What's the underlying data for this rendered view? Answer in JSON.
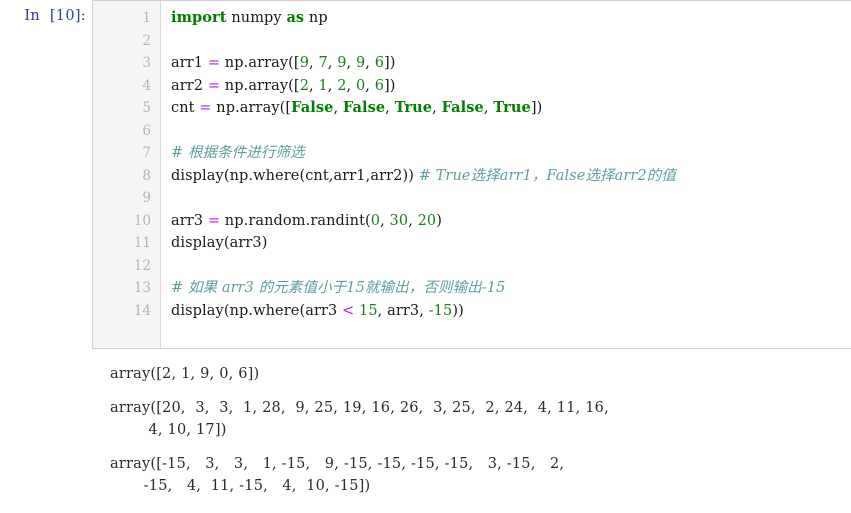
{
  "cell": {
    "prompt_label": "In  [10]:",
    "line_numbers": [
      "1",
      "2",
      "3",
      "4",
      "5",
      "6",
      "7",
      "8",
      "9",
      "10",
      "11",
      "12",
      "13",
      "14"
    ],
    "code_lines": [
      [
        {
          "t": "import",
          "c": "kw"
        },
        {
          "t": " numpy ",
          "c": "plain"
        },
        {
          "t": "as",
          "c": "kw"
        },
        {
          "t": " np",
          "c": "plain"
        }
      ],
      [],
      [
        {
          "t": "arr1 ",
          "c": "plain"
        },
        {
          "t": "=",
          "c": "op"
        },
        {
          "t": " np.array([",
          "c": "plain"
        },
        {
          "t": "9",
          "c": "num"
        },
        {
          "t": ", ",
          "c": "plain"
        },
        {
          "t": "7",
          "c": "num"
        },
        {
          "t": ", ",
          "c": "plain"
        },
        {
          "t": "9",
          "c": "num"
        },
        {
          "t": ", ",
          "c": "plain"
        },
        {
          "t": "9",
          "c": "num"
        },
        {
          "t": ", ",
          "c": "plain"
        },
        {
          "t": "6",
          "c": "num"
        },
        {
          "t": "])",
          "c": "plain"
        }
      ],
      [
        {
          "t": "arr2 ",
          "c": "plain"
        },
        {
          "t": "=",
          "c": "op"
        },
        {
          "t": " np.array([",
          "c": "plain"
        },
        {
          "t": "2",
          "c": "num"
        },
        {
          "t": ", ",
          "c": "plain"
        },
        {
          "t": "1",
          "c": "num"
        },
        {
          "t": ", ",
          "c": "plain"
        },
        {
          "t": "2",
          "c": "num"
        },
        {
          "t": ", ",
          "c": "plain"
        },
        {
          "t": "0",
          "c": "num"
        },
        {
          "t": ", ",
          "c": "plain"
        },
        {
          "t": "6",
          "c": "num"
        },
        {
          "t": "])",
          "c": "plain"
        }
      ],
      [
        {
          "t": "cnt ",
          "c": "plain"
        },
        {
          "t": "=",
          "c": "op"
        },
        {
          "t": " np.array([",
          "c": "plain"
        },
        {
          "t": "False",
          "c": "builtin"
        },
        {
          "t": ", ",
          "c": "plain"
        },
        {
          "t": "False",
          "c": "builtin"
        },
        {
          "t": ", ",
          "c": "plain"
        },
        {
          "t": "True",
          "c": "builtin"
        },
        {
          "t": ", ",
          "c": "plain"
        },
        {
          "t": "False",
          "c": "builtin"
        },
        {
          "t": ", ",
          "c": "plain"
        },
        {
          "t": "True",
          "c": "builtin"
        },
        {
          "t": "])",
          "c": "plain"
        }
      ],
      [],
      [
        {
          "t": "# 根据条件进行筛选",
          "c": "comment"
        }
      ],
      [
        {
          "t": "display(np.where(cnt,arr1,arr2)) ",
          "c": "plain"
        },
        {
          "t": "# True选择arr1，False选择arr2的值",
          "c": "comment"
        }
      ],
      [],
      [
        {
          "t": "arr3 ",
          "c": "plain"
        },
        {
          "t": "=",
          "c": "op"
        },
        {
          "t": " np.random.randint(",
          "c": "plain"
        },
        {
          "t": "0",
          "c": "num"
        },
        {
          "t": ", ",
          "c": "plain"
        },
        {
          "t": "30",
          "c": "num"
        },
        {
          "t": ", ",
          "c": "plain"
        },
        {
          "t": "20",
          "c": "num"
        },
        {
          "t": ")",
          "c": "plain"
        }
      ],
      [
        {
          "t": "display(arr3)",
          "c": "plain"
        }
      ],
      [],
      [
        {
          "t": "# 如果 arr3 的元素值小于15就输出，否则输出-15",
          "c": "comment"
        }
      ],
      [
        {
          "t": "display(np.where(arr3 ",
          "c": "plain"
        },
        {
          "t": "<",
          "c": "op"
        },
        {
          "t": " ",
          "c": "plain"
        },
        {
          "t": "15",
          "c": "num"
        },
        {
          "t": ", arr3, ",
          "c": "plain"
        },
        {
          "t": "-15",
          "c": "num"
        },
        {
          "t": "))",
          "c": "plain"
        }
      ]
    ]
  },
  "outputs": [
    {
      "prompt_label": "",
      "lines": [
        "array([2, 1, 9, 0, 6])"
      ]
    },
    {
      "prompt_label": "",
      "lines": [
        "array([20,  3,  3,  1, 28,  9, 25, 19, 16, 26,  3, 25,  2, 24,  4, 11, 16,",
        "        4, 10, 17])"
      ]
    },
    {
      "prompt_label": "",
      "lines": [
        "array([-15,   3,   3,   1, -15,   9, -15, -15, -15, -15,   3, -15,   2,",
        "       -15,   4,  11, -15,   4,  10, -15])"
      ]
    }
  ],
  "colors": {
    "prompt_blue": "#303f9f",
    "keyword_green": "#008000",
    "operator_purple": "#aa22ff",
    "number_green": "#1c7d1c",
    "comment_teal": "#5f9ea0",
    "gutter_bg": "#f5f5f5",
    "cell_border": "#cfcfcf"
  }
}
